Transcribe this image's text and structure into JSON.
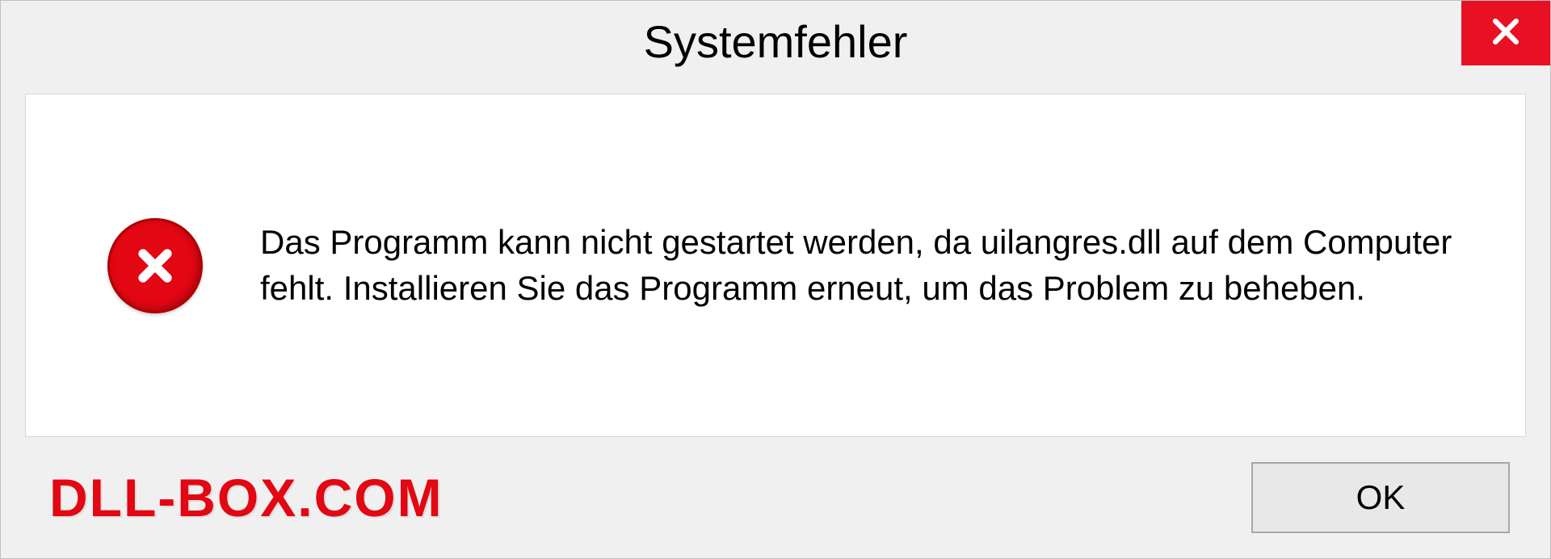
{
  "dialog": {
    "title": "Systemfehler",
    "message": "Das Programm kann nicht gestartet werden, da uilangres.dll auf dem Computer fehlt. Installieren Sie das Programm erneut, um das Problem zu beheben.",
    "ok_label": "OK"
  },
  "watermark": "DLL-BOX.COM",
  "colors": {
    "close_bg": "#e81123",
    "error_icon": "#e30613",
    "watermark": "#e30613"
  }
}
